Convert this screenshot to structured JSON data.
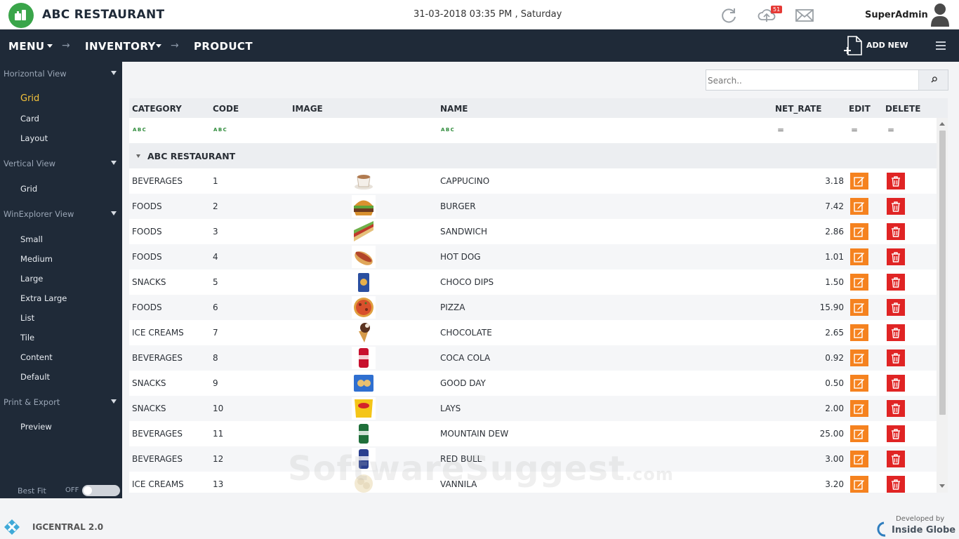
{
  "header": {
    "app_title": "ABC RESTAURANT",
    "datetime": "31-03-2018  03:35 PM , Saturday",
    "upload_badge": "51",
    "user_name": "SuperAdmin"
  },
  "nav": {
    "menu": "MENU",
    "inventory": "INVENTORY",
    "product": "PRODUCT",
    "add_new": "ADD NEW"
  },
  "sidebar": {
    "sections": [
      {
        "label": "Horizontal View",
        "items": [
          "Grid",
          "Card",
          "Layout"
        ]
      },
      {
        "label": "Vertical View",
        "items": [
          "Grid"
        ]
      },
      {
        "label": "WinExplorer View",
        "items": [
          "Small",
          "Medium",
          "Large",
          "Extra Large",
          "List",
          "Tile",
          "Content",
          "Default"
        ]
      },
      {
        "label": "Print & Export",
        "items": [
          "Preview"
        ]
      }
    ],
    "active_item": "Grid",
    "best_fit": "Best Fit",
    "toggle_state": "OFF"
  },
  "search": {
    "placeholder": "Search.."
  },
  "grid": {
    "columns": [
      "CATEGORY",
      "CODE",
      "IMAGE",
      "NAME",
      "NET_RATE",
      "EDIT",
      "DELETE"
    ],
    "filter_abc": "A B C",
    "filter_eq": "=",
    "group_label": "ABC RESTAURANT",
    "rows": [
      {
        "category": "BEVERAGES",
        "code": "1",
        "name": "CAPPUCINO",
        "net_rate": "3.18",
        "image": "cup-icon"
      },
      {
        "category": "FOODS",
        "code": "2",
        "name": "BURGER",
        "net_rate": "7.42",
        "image": "burger-icon"
      },
      {
        "category": "FOODS",
        "code": "3",
        "name": "SANDWICH",
        "net_rate": "2.86",
        "image": "sandwich-icon"
      },
      {
        "category": "FOODS",
        "code": "4",
        "name": "HOT DOG",
        "net_rate": "1.01",
        "image": "hotdog-icon"
      },
      {
        "category": "SNACKS",
        "code": "5",
        "name": "CHOCO DIPS",
        "net_rate": "1.50",
        "image": "snack-pack-icon"
      },
      {
        "category": "FOODS",
        "code": "6",
        "name": "PIZZA",
        "net_rate": "15.90",
        "image": "pizza-icon"
      },
      {
        "category": "ICE CREAMS",
        "code": "7",
        "name": "CHOCOLATE",
        "net_rate": "2.65",
        "image": "ice-cream-cone-icon"
      },
      {
        "category": "BEVERAGES",
        "code": "8",
        "name": "COCA COLA",
        "net_rate": "0.92",
        "image": "can-icon"
      },
      {
        "category": "SNACKS",
        "code": "9",
        "name": "GOOD DAY",
        "net_rate": "0.50",
        "image": "biscuit-pack-icon"
      },
      {
        "category": "SNACKS",
        "code": "10",
        "name": "LAYS",
        "net_rate": "2.00",
        "image": "chips-pack-icon"
      },
      {
        "category": "BEVERAGES",
        "code": "11",
        "name": "MOUNTAIN DEW",
        "net_rate": "25.00",
        "image": "can-icon"
      },
      {
        "category": "BEVERAGES",
        "code": "12",
        "name": "RED BULL",
        "net_rate": "3.00",
        "image": "can-icon"
      },
      {
        "category": "ICE CREAMS",
        "code": "13",
        "name": "VANNILA",
        "net_rate": "3.20",
        "image": "ice-cream-cup-icon"
      }
    ]
  },
  "watermark": {
    "main": "SoftwareSuggest",
    "suffix": ".com"
  },
  "footer": {
    "product": "IGCENTRAL  2.0",
    "developed_by": "Developed by",
    "company": "Inside Globe"
  },
  "colors": {
    "navy": "#1f2a38",
    "accent_yellow": "#f5c33b",
    "edit_orange": "#f5821f",
    "delete_red": "#e02424",
    "logo_green": "#3aa54a"
  }
}
